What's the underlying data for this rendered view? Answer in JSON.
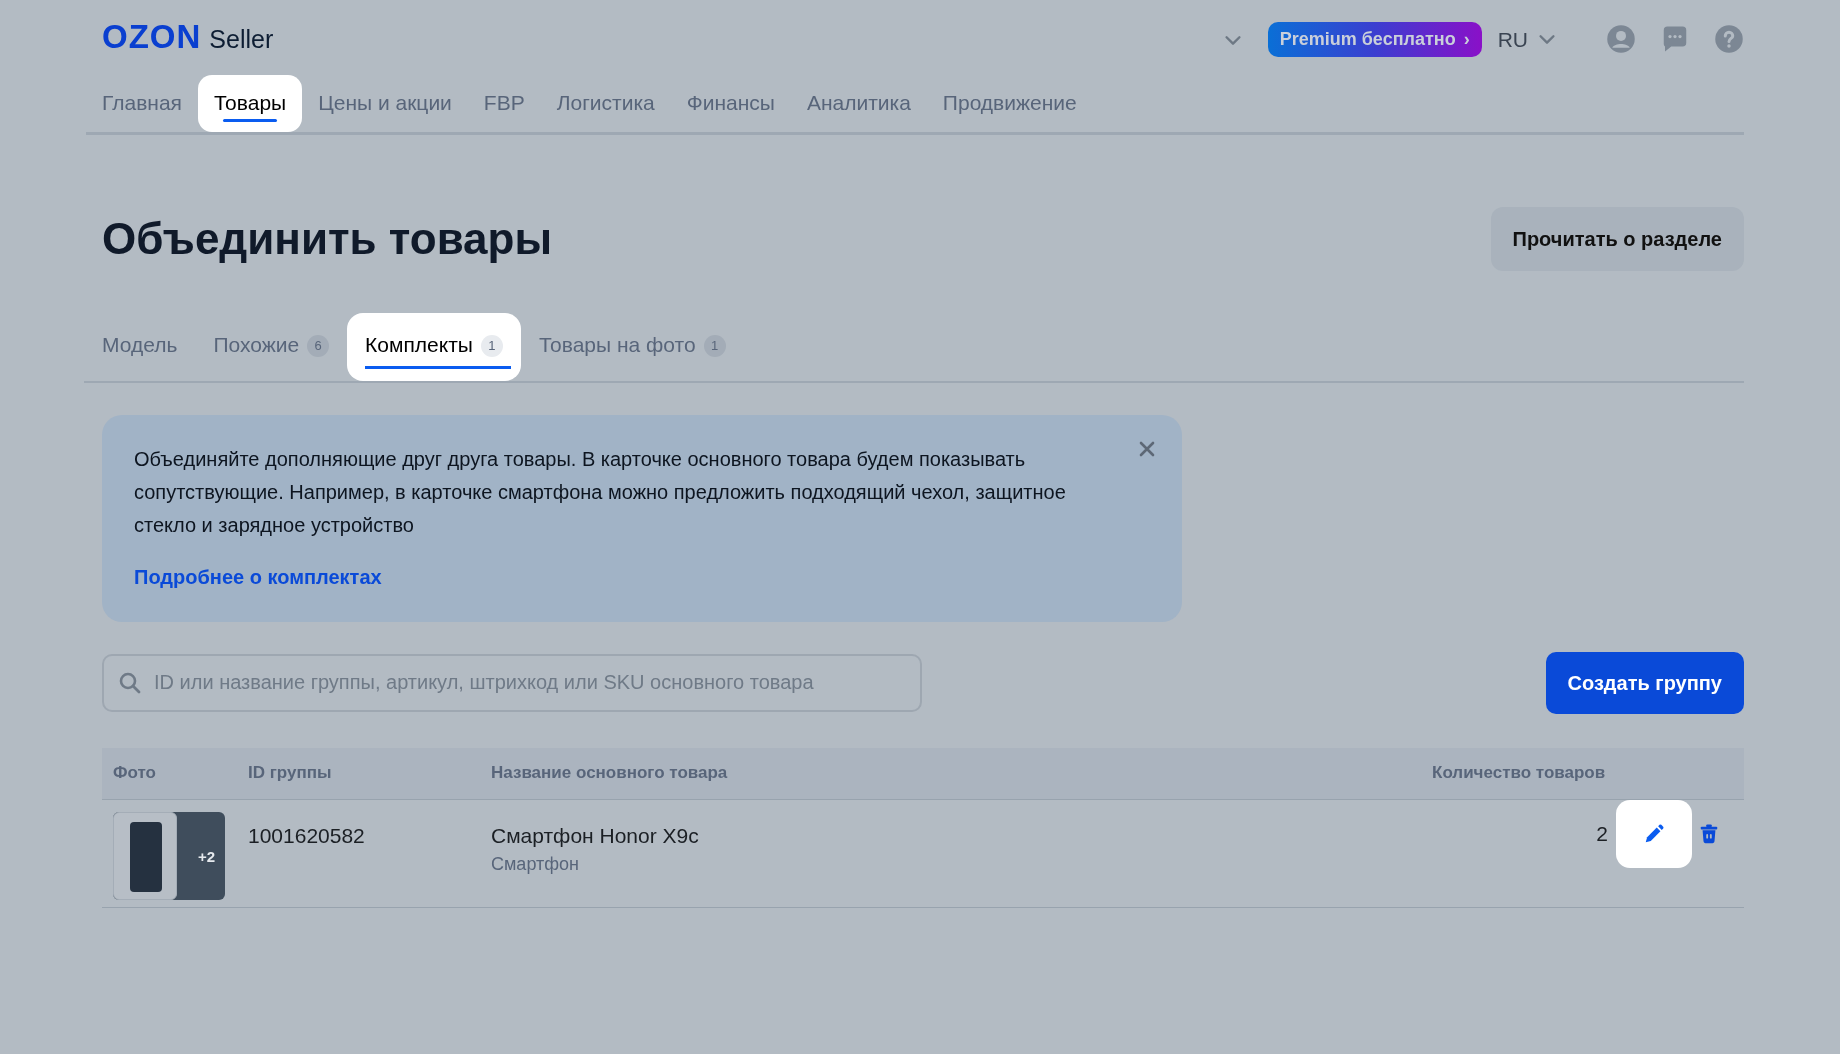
{
  "header": {
    "logo": "OZON",
    "logo_suffix": "Seller",
    "premium": "Premium бесплатно",
    "premium_arrow": "›",
    "language": "RU"
  },
  "nav": [
    {
      "label": "Главная",
      "selected": false,
      "highlighted": false
    },
    {
      "label": "Товары",
      "selected": true,
      "highlighted": true
    },
    {
      "label": "Цены и акции",
      "selected": false,
      "highlighted": false
    },
    {
      "label": "FBP",
      "selected": false,
      "highlighted": false
    },
    {
      "label": "Логистика",
      "selected": false,
      "highlighted": false
    },
    {
      "label": "Финансы",
      "selected": false,
      "highlighted": false
    },
    {
      "label": "Аналитика",
      "selected": false,
      "highlighted": false
    },
    {
      "label": "Продвижение",
      "selected": false,
      "highlighted": false
    }
  ],
  "page": {
    "title": "Объединить товары",
    "read_button": "Прочитать о разделе"
  },
  "tabs": [
    {
      "label": "Модель",
      "selected": false,
      "highlighted": false
    },
    {
      "label": "Похожие",
      "count": "6",
      "selected": false,
      "highlighted": false
    },
    {
      "label": "Комплекты",
      "count": "1",
      "selected": true,
      "highlighted": true
    },
    {
      "label": "Товары на фото",
      "count": "1",
      "selected": false,
      "highlighted": false
    }
  ],
  "info": {
    "text": "Объединяйте дополняющие друг друга товары. В карточке основного товара будем показывать сопутствующие. Например, в карточке смартфона можно предложить подходящий чехол, защитное стекло и зарядное устройство",
    "link": "Подробнее о комплектах"
  },
  "search": {
    "placeholder": "ID или название группы, артикул, штрихкод или SKU основного товара"
  },
  "create_button": "Создать группу",
  "table": {
    "columns": [
      "Фото",
      "ID группы",
      "Название основного товара",
      "Количество товаров"
    ],
    "rows": [
      {
        "extra_photos": "+2",
        "id": "1001620582",
        "name": "Смартфон Honor X9c",
        "category": "Смартфон",
        "count": "2",
        "edit_highlighted": true
      }
    ]
  }
}
